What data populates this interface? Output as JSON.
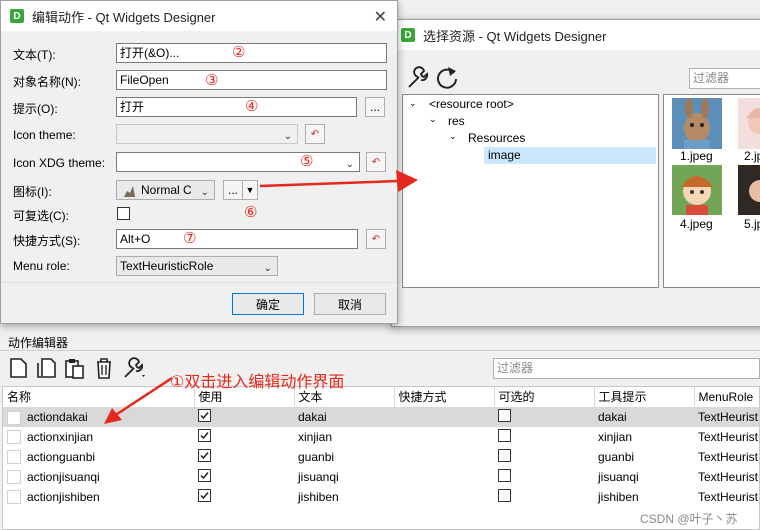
{
  "edit_dialog": {
    "title": "编辑动作 - Qt Widgets Designer",
    "app_icon_letter": "D",
    "labels": {
      "text": "文本(T):",
      "object_name": "对象名称(N):",
      "tooltip": "提示(O):",
      "icon_theme": "Icon theme:",
      "icon_xdg_theme": "Icon XDG theme:",
      "icon": "图标(I):",
      "checkable": "可复选(C):",
      "shortcut": "快捷方式(S):",
      "menu_role": "Menu role:"
    },
    "values": {
      "text": "打开(&O)...",
      "object_name": "FileOpen",
      "tooltip": "打开",
      "icon_theme": "",
      "icon_xdg_theme": "",
      "icon_mode": "Normal C",
      "shortcut": "Alt+O",
      "menu_role": "TextHeuristicRole"
    },
    "browse_label": "...",
    "ok_label": "确定",
    "cancel_label": "取消",
    "annotations": [
      "②",
      "③",
      "④",
      "⑤",
      "⑥",
      "⑦"
    ]
  },
  "resource_dialog": {
    "title": "选择资源 - Qt Widgets Designer",
    "filter_placeholder": "过滤器",
    "tree": [
      "<resource root>",
      "res",
      "Resources",
      "image"
    ],
    "thumbnails": [
      "1.jpeg",
      "2.jp",
      "4.jpeg",
      "5.jp"
    ]
  },
  "action_editor": {
    "title": "动作编辑器",
    "filter_placeholder": "过滤器",
    "annotation": "①双击进入编辑动作界面",
    "columns": [
      "名称",
      "使用",
      "文本",
      "快捷方式",
      "可选的",
      "工具提示",
      "MenuRole"
    ],
    "rows": [
      {
        "name": "actiondakai",
        "used": true,
        "text": "dakai",
        "shortcut": "",
        "checkable": false,
        "tooltip": "dakai",
        "role": "TextHeurist"
      },
      {
        "name": "actionxinjian",
        "used": true,
        "text": "xinjian",
        "shortcut": "",
        "checkable": false,
        "tooltip": "xinjian",
        "role": "TextHeurist"
      },
      {
        "name": "actionguanbi",
        "used": true,
        "text": "guanbi",
        "shortcut": "",
        "checkable": false,
        "tooltip": "guanbi",
        "role": "TextHeurist"
      },
      {
        "name": "actionjisuanqi",
        "used": true,
        "text": "jisuanqi",
        "shortcut": "",
        "checkable": false,
        "tooltip": "jisuanqi",
        "role": "TextHeurist"
      },
      {
        "name": "actionjishiben",
        "used": true,
        "text": "jishiben",
        "shortcut": "",
        "checkable": false,
        "tooltip": "jishiben",
        "role": "TextHeurist"
      }
    ]
  },
  "watermark": "CSDN @叶子丶苏",
  "colors": {
    "accent_red": "#e6291e",
    "selection": "#cce8ff",
    "app_icon": "#3aa63a"
  }
}
